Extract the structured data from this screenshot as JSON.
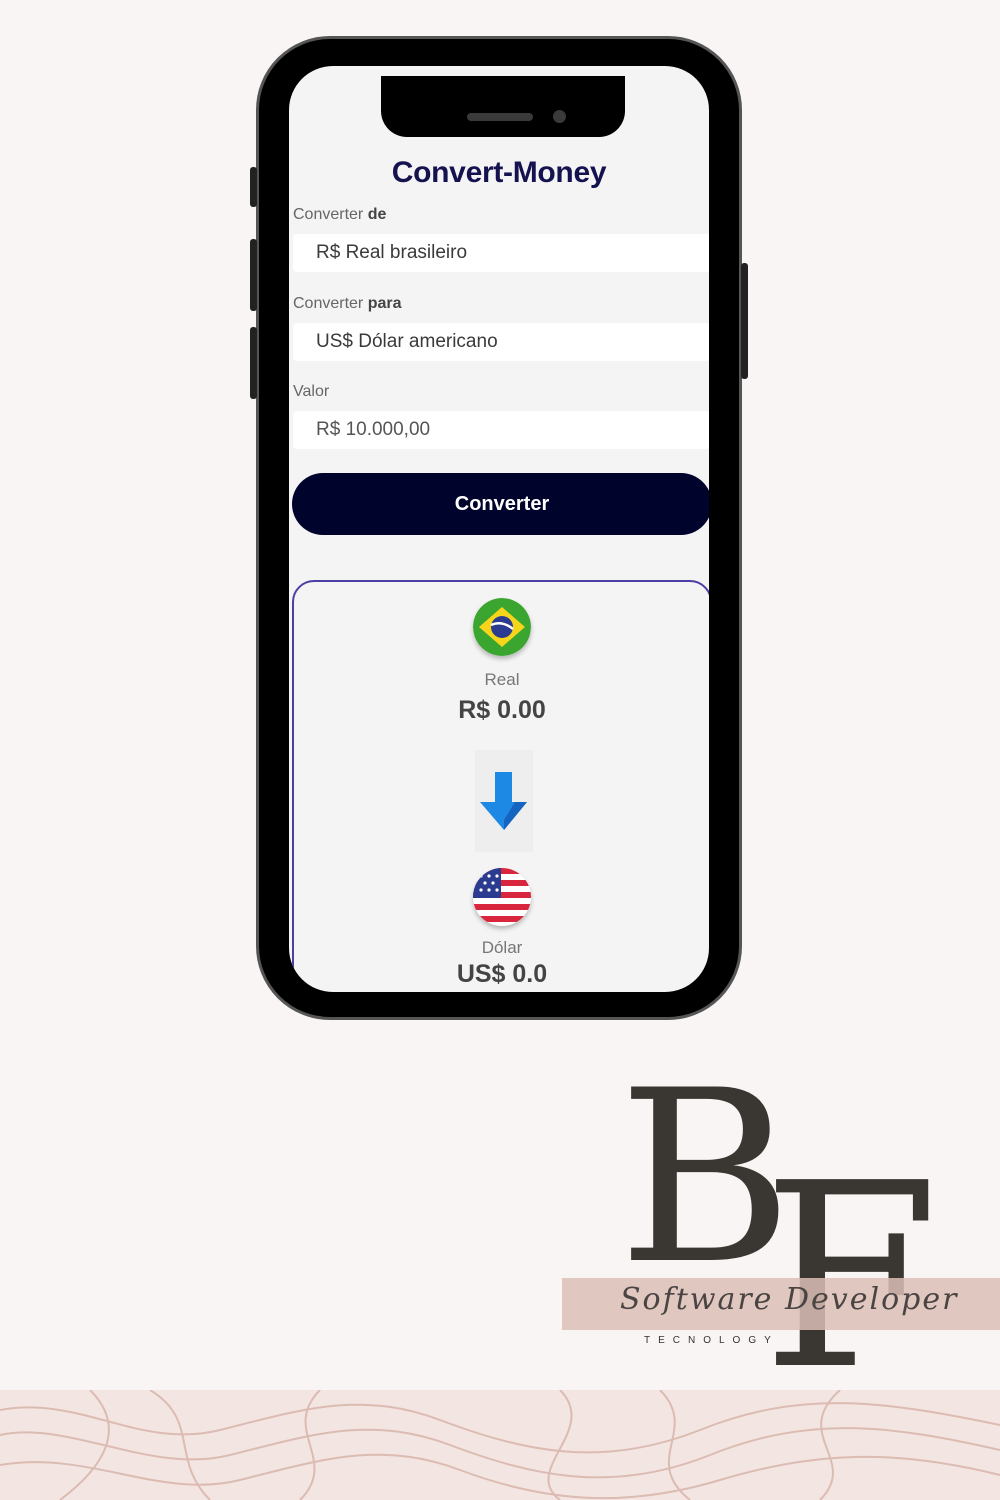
{
  "app": {
    "title": "Convert-Money",
    "from": {
      "label_prefix": "Converter",
      "label_bold": "de",
      "value": "R$ Real brasileiro"
    },
    "to": {
      "label_prefix": "Converter",
      "label_bold": "para",
      "value": "US$ Dólar americano"
    },
    "amount": {
      "label": "Valor",
      "placeholder": "R$ 10.000,00"
    },
    "convert_button": "Converter",
    "result": {
      "source": {
        "name": "Real",
        "value": "R$ 0.00",
        "flag": "brazil-flag"
      },
      "arrow": "arrow-down-icon",
      "target": {
        "name": "Dólar",
        "value": "US$ 0.0",
        "flag": "usa-flag"
      }
    }
  },
  "logo": {
    "letters": "BF",
    "script": "Software Developer",
    "tagline": "TECNOLOGY"
  },
  "colors": {
    "background": "#f9f5f4",
    "title": "#14124f",
    "button": "#00032c",
    "result_border": "#4b3fa6",
    "logo_band": "#dcbeb6"
  }
}
